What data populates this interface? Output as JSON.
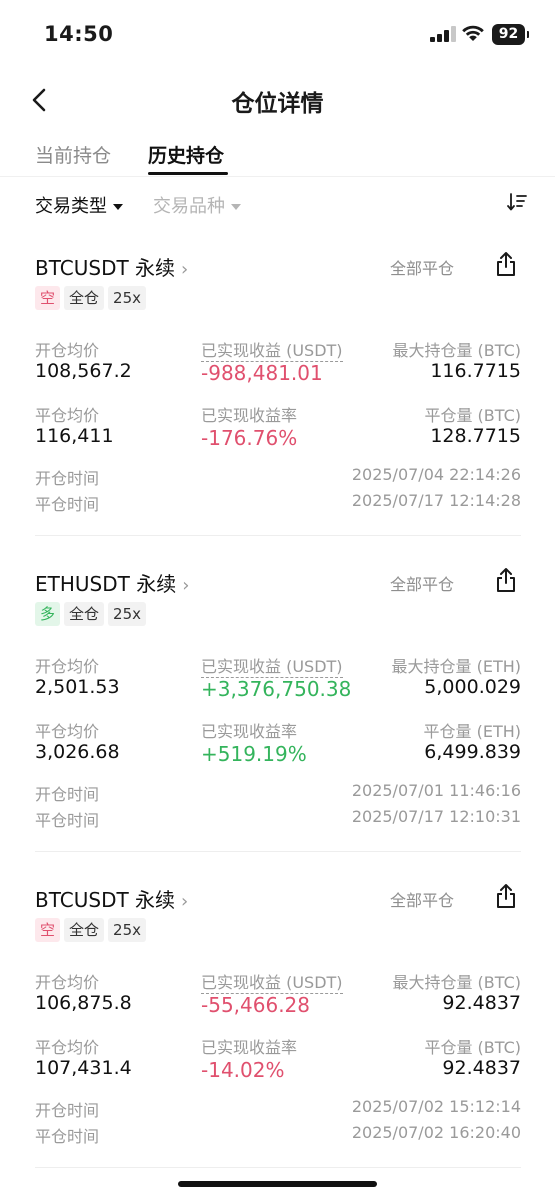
{
  "status": {
    "time": "14:50",
    "battery": "92"
  },
  "nav": {
    "title": "仓位详情"
  },
  "tabs": {
    "current": "当前持仓",
    "history": "历史持仓"
  },
  "filters": {
    "type": "交易类型",
    "symbol": "交易品种"
  },
  "positions": [
    {
      "symbol": "BTCUSDT 永续",
      "close_all": "全部平仓",
      "side": "空",
      "margin_mode": "全仓",
      "leverage": "25x",
      "open_price_label": "开仓均价",
      "open_price": "108,567.2",
      "pnl_label": "已实现收益 (USDT)",
      "pnl": "-988,481.01",
      "max_label": "最大持仓量 (BTC)",
      "max_size": "116.7715",
      "close_price_label": "平仓均价",
      "close_price": "116,411",
      "pnl_rate_label": "已实现收益率",
      "pnl_rate": "-176.76%",
      "closed_label": "平仓量 (BTC)",
      "closed_size": "128.7715",
      "open_time_label": "开仓时间",
      "open_time": "2025/07/04 22:14:26",
      "close_time_label": "平仓时间",
      "close_time": "2025/07/17 12:14:28"
    },
    {
      "symbol": "ETHUSDT 永续",
      "close_all": "全部平仓",
      "side": "多",
      "margin_mode": "全仓",
      "leverage": "25x",
      "open_price_label": "开仓均价",
      "open_price": "2,501.53",
      "pnl_label": "已实现收益 (USDT)",
      "pnl": "+3,376,750.38",
      "max_label": "最大持仓量 (ETH)",
      "max_size": "5,000.029",
      "close_price_label": "平仓均价",
      "close_price": "3,026.68",
      "pnl_rate_label": "已实现收益率",
      "pnl_rate": "+519.19%",
      "closed_label": "平仓量 (ETH)",
      "closed_size": "6,499.839",
      "open_time_label": "开仓时间",
      "open_time": "2025/07/01 11:46:16",
      "close_time_label": "平仓时间",
      "close_time": "2025/07/17 12:10:31"
    },
    {
      "symbol": "BTCUSDT 永续",
      "close_all": "全部平仓",
      "side": "空",
      "margin_mode": "全仓",
      "leverage": "25x",
      "open_price_label": "开仓均价",
      "open_price": "106,875.8",
      "pnl_label": "已实现收益 (USDT)",
      "pnl": "-55,466.28",
      "max_label": "最大持仓量 (BTC)",
      "max_size": "92.4837",
      "close_price_label": "平仓均价",
      "close_price": "107,431.4",
      "pnl_rate_label": "已实现收益率",
      "pnl_rate": "-14.02%",
      "closed_label": "平仓量 (BTC)",
      "closed_size": "92.4837",
      "open_time_label": "开仓时间",
      "open_time": "2025/07/02 15:12:14",
      "close_time_label": "平仓时间",
      "close_time": "2025/07/02 16:20:40"
    }
  ],
  "colors": {
    "loss": "#e0506e",
    "profit": "#34b45c"
  }
}
